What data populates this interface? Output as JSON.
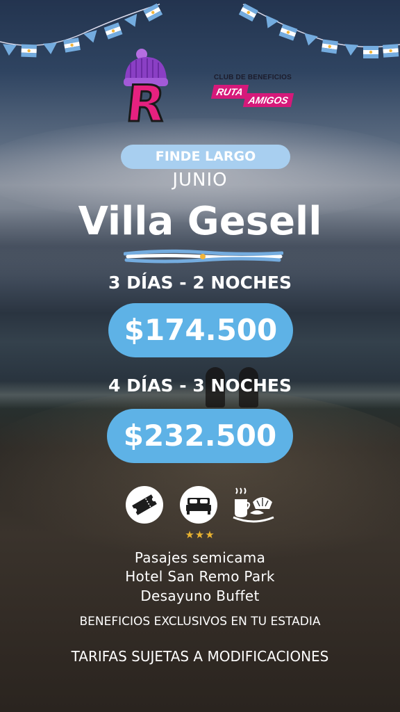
{
  "brand": {
    "logo_letter": "R",
    "club_title": "CLUB DE BENEFICIOS",
    "club_tag_1": "RUTA",
    "club_tag_2": "AMIGOS"
  },
  "promo": {
    "badge": "FINDE LARGO",
    "month": "JUNIO",
    "destination": "Villa Gesell"
  },
  "packages": [
    {
      "duration": "3 DÍAS - 2 NOCHES",
      "price": "$174.500"
    },
    {
      "duration": "4 DÍAS - 3 NOCHES",
      "price": "$232.500"
    }
  ],
  "amenities": {
    "icons": [
      "ticket-icon",
      "bed-icon",
      "breakfast-icon"
    ],
    "hotel_stars": 3,
    "stars_text": "★★★",
    "items": [
      "Pasajes semicama",
      "Hotel San Remo Park",
      "Desayuno Buffet"
    ]
  },
  "footer": {
    "benefits": "BENEFICIOS EXCLUSIVOS EN TU ESTADIA",
    "disclaimer": "TARIFAS SUJETAS A MODIFICACIONES"
  },
  "colors": {
    "price_pill": "#5eb2e6",
    "badge_pill": "#a8cff0",
    "brand_pink": "#d6197a",
    "hat_purple": "#8a3fc4",
    "flag_blue": "#74acdf",
    "star_gold": "#e9b330"
  }
}
